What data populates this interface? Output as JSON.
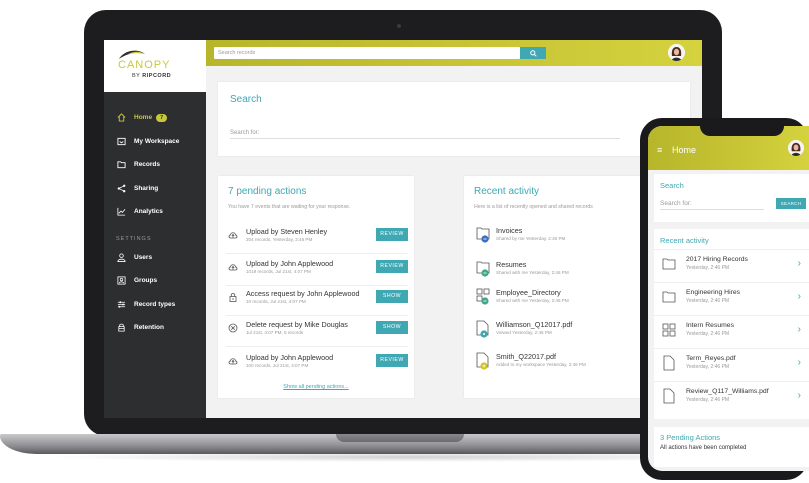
{
  "brand": {
    "name": "CANOPY",
    "sub_prefix": "BY",
    "sub_name": "RIPCORD"
  },
  "colors": {
    "accent": "#c8c93a",
    "teal": "#3fa8b3",
    "sidebar": "#2d2e30"
  },
  "sidebar": {
    "items": [
      {
        "label": "Home",
        "icon": "home-icon",
        "badge": "7",
        "active": true
      },
      {
        "label": "My Workspace",
        "icon": "workspace-icon"
      },
      {
        "label": "Records",
        "icon": "folder-icon"
      },
      {
        "label": "Sharing",
        "icon": "share-icon"
      },
      {
        "label": "Analytics",
        "icon": "analytics-icon"
      }
    ],
    "settings_label": "SETTINGS",
    "settings_items": [
      {
        "label": "Users",
        "icon": "user-icon"
      },
      {
        "label": "Groups",
        "icon": "groups-icon"
      },
      {
        "label": "Record types",
        "icon": "sliders-icon"
      },
      {
        "label": "Retention",
        "icon": "retention-icon"
      }
    ]
  },
  "topbar": {
    "search_placeholder": "Search records",
    "search_button_icon": "search-icon"
  },
  "search_card": {
    "title": "Search",
    "field_label": "Search for:"
  },
  "pending": {
    "title": "7 pending actions",
    "subtitle": "You have 7 events that are waiting for your response.",
    "items": [
      {
        "icon": "upload-icon",
        "title": "Upload by Steven Henley",
        "meta": "204 records, Yesterday, 2:46 PM",
        "button": "REVIEW"
      },
      {
        "icon": "upload-icon",
        "title": "Upload by John Applewood",
        "meta": "1019 records, Jul 21st, 4:07 PM",
        "button": "REVIEW"
      },
      {
        "icon": "lock-icon",
        "title": "Access request by John Applewood",
        "meta": "10 records, Jul 21st, 4:07 PM",
        "button": "SHOW"
      },
      {
        "icon": "delete-icon",
        "title": "Delete request by Mike Douglas",
        "meta": "Jul 21st, 4:07 PM, 5 records",
        "button": "SHOW"
      },
      {
        "icon": "upload-icon",
        "title": "Upload by John Applewood",
        "meta": "100 records, Jul 21st, 4:07 PM",
        "button": "REVIEW"
      }
    ],
    "show_all": "Show all pending actions..."
  },
  "recent": {
    "title": "Recent activity",
    "subtitle": "Here is a list of recently opened and shared records",
    "items": [
      {
        "icon": "folder-shared-icon",
        "title": "Invoices",
        "meta": "Shared by me Yesterday, 2:46 PM"
      },
      {
        "icon": "folder-shared-icon",
        "title": "Resumes",
        "meta": "Shared with me Yesterday, 2:46 PM"
      },
      {
        "icon": "grid-shared-icon",
        "title": "Employee_Directory",
        "meta": "Shared with me Yesterday, 2:46 PM"
      },
      {
        "icon": "file-viewed-icon",
        "title": "Williamson_Q12017.pdf",
        "meta": "Viewed Yesterday, 2:46 PM"
      },
      {
        "icon": "file-added-icon",
        "title": "Smith_Q22017.pdf",
        "meta": "Added to my workspace Yesterday, 2:46 PM"
      }
    ]
  },
  "phone": {
    "title": "Home",
    "search_title": "Search",
    "search_label": "Search for:",
    "search_button": "SEARCH",
    "recent_title": "Recent activity",
    "recent_items": [
      {
        "icon": "folder-icon",
        "title": "2017 Hiring Records",
        "meta": "Yesterday, 2:46 PM"
      },
      {
        "icon": "folder-icon",
        "title": "Engineering Hires",
        "meta": "Yesterday, 2:46 PM"
      },
      {
        "icon": "grid-icon",
        "title": "Intern Resumes",
        "meta": "Yesterday, 2:46 PM"
      },
      {
        "icon": "file-icon",
        "title": "Term_Reyes.pdf",
        "meta": "Yesterday, 2:46 PM"
      },
      {
        "icon": "file-icon",
        "title": "Review_Q117_Williams.pdf",
        "meta": "Yesterday, 2:46 PM"
      }
    ],
    "pending_title": "3 Pending Actions",
    "pending_sub": "All actions have been completed"
  }
}
